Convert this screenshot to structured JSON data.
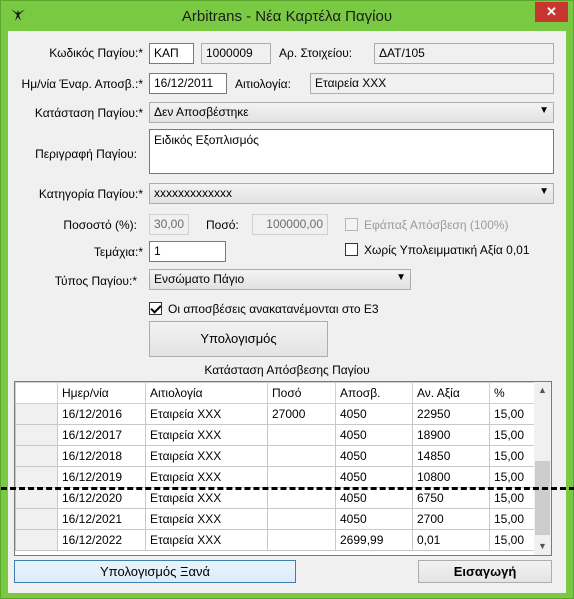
{
  "window": {
    "title": "Arbitrans - Νέα Καρτέλα Παγίου",
    "close_glyph": "✕",
    "accent": "#7ac943"
  },
  "form": {
    "code_label": "Κωδικός Παγίου:*",
    "code_prefix": "ΚΑΠ",
    "code_number": "1000009",
    "doc_no_label": "Αρ. Στοιχείου:",
    "doc_no_value": "ΔΑΤ/105",
    "start_date_label": "Ημ/νία Έναρ. Αποσβ.:*",
    "start_date_value": "16/12/2011",
    "reason_label": "Αιτιολογία:",
    "reason_value": "Εταιρεία ΧΧΧ",
    "status_label": "Κατάσταση Παγίου:*",
    "status_value": "Δεν Αποσβέστηκε",
    "description_label": "Περιγραφή Παγίου:",
    "description_value": "Ειδικός Εξοπλισμός",
    "category_label": "Κατηγορία Παγίου:*",
    "category_value": "xxxxxxxxxxxxx",
    "percent_label": "Ποσοστό (%):",
    "percent_value": "30,00",
    "amount_label": "Ποσό:",
    "amount_value": "100000,00",
    "onetime_label": "Εφάπαξ Απόσβεση (100%)",
    "pieces_label": "Τεμάχια:*",
    "pieces_value": "1",
    "no_residual_label": "Χωρίς Υπολειμματική Αξία 0,01",
    "type_label": "Τύπος Παγίου:*",
    "type_value": "Ενσώματο Πάγιο",
    "reverse_label": "Οι αποσβέσεις ανακατανέμονται στο Ε3",
    "calc_button": "Υπολογισμός",
    "grid_title": "Κατάσταση Απόσβεσης Παγίου"
  },
  "grid": {
    "columns": [
      "Ημερ/νία",
      "Αιτιολογία",
      "Ποσό",
      "Αποσβ.",
      "Αν. Αξία",
      "%"
    ],
    "rows": [
      [
        "16/12/2016",
        "Εταιρεία ΧΧΧ",
        "27000",
        "4050",
        "22950",
        "15,00"
      ],
      [
        "16/12/2017",
        "Εταιρεία ΧΧΧ",
        "",
        "4050",
        "18900",
        "15,00"
      ],
      [
        "16/12/2018",
        "Εταιρεία ΧΧΧ",
        "",
        "4050",
        "14850",
        "15,00"
      ],
      [
        "16/12/2019",
        "Εταιρεία ΧΧΧ",
        "",
        "4050",
        "10800",
        "15,00"
      ],
      [
        "16/12/2020",
        "Εταιρεία ΧΧΧ",
        "",
        "4050",
        "6750",
        "15,00"
      ],
      [
        "16/12/2021",
        "Εταιρεία ΧΧΧ",
        "",
        "4050",
        "2700",
        "15,00"
      ],
      [
        "16/12/2022",
        "Εταιρεία ΧΧΧ",
        "",
        "2699,99",
        "0,01",
        "15,00"
      ]
    ]
  },
  "footer": {
    "recalc_button": "Υπολογισμός Ξανά",
    "insert_button": "Εισαγωγή"
  },
  "checks": {
    "onetime": false,
    "no_residual": false,
    "reverse": true
  }
}
